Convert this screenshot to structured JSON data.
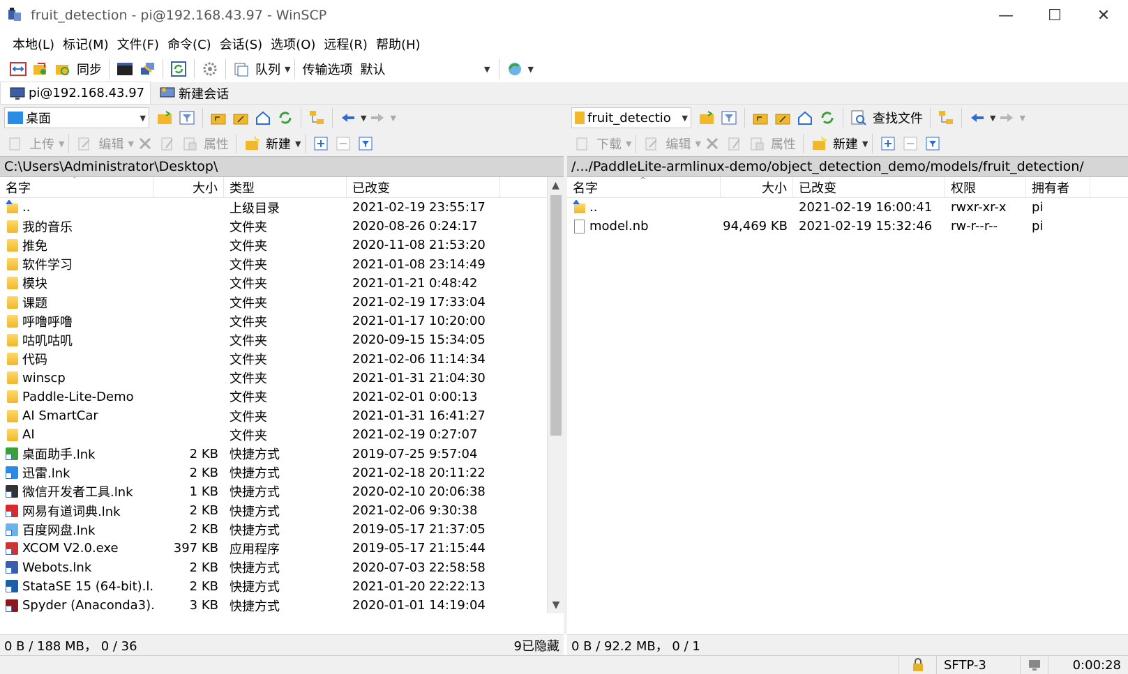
{
  "window": {
    "title": "fruit_detection - pi@192.168.43.97 - WinSCP",
    "minimize": "—",
    "maximize": "☐",
    "close": "✕"
  },
  "menu": [
    "本地(L)",
    "标记(M)",
    "文件(F)",
    "命令(C)",
    "会话(S)",
    "选项(O)",
    "远程(R)",
    "帮助(H)"
  ],
  "toolbar": {
    "sync_label": "同步",
    "queue_label": "队列",
    "transfer_label": "传输选项",
    "transfer_value": "默认"
  },
  "sessions": {
    "active": "pi@192.168.43.97",
    "new": "新建会话"
  },
  "left": {
    "location": "桌面",
    "actions": {
      "upload": "上传",
      "edit": "编辑",
      "properties": "属性",
      "new": "新建"
    },
    "path": "C:\\Users\\Administrator\\Desktop\\",
    "columns": {
      "name": "名字",
      "size": "大小",
      "type": "类型",
      "changed": "已改变"
    },
    "rows": [
      {
        "name": "..",
        "size": "",
        "type": "上级目录",
        "date": "2021-02-19",
        "time": "23:55:17",
        "icon": "parent"
      },
      {
        "name": "我的音乐",
        "size": "",
        "type": "文件夹",
        "date": "2020-08-26",
        "time": "0:24:17",
        "icon": "folder"
      },
      {
        "name": "推免",
        "size": "",
        "type": "文件夹",
        "date": "2020-11-08",
        "time": "21:53:20",
        "icon": "folder"
      },
      {
        "name": "软件学习",
        "size": "",
        "type": "文件夹",
        "date": "2021-01-08",
        "time": "23:14:49",
        "icon": "folder"
      },
      {
        "name": "模块",
        "size": "",
        "type": "文件夹",
        "date": "2021-01-21",
        "time": "0:48:42",
        "icon": "folder"
      },
      {
        "name": "课题",
        "size": "",
        "type": "文件夹",
        "date": "2021-02-19",
        "time": "17:33:04",
        "icon": "folder"
      },
      {
        "name": "呼噜呼噜",
        "size": "",
        "type": "文件夹",
        "date": "2021-01-17",
        "time": "10:20:00",
        "icon": "folder"
      },
      {
        "name": "咕叽咕叽",
        "size": "",
        "type": "文件夹",
        "date": "2020-09-15",
        "time": "15:34:05",
        "icon": "folder"
      },
      {
        "name": "代码",
        "size": "",
        "type": "文件夹",
        "date": "2021-02-06",
        "time": "11:14:34",
        "icon": "folder"
      },
      {
        "name": "winscp",
        "size": "",
        "type": "文件夹",
        "date": "2021-01-31",
        "time": "21:04:30",
        "icon": "folder"
      },
      {
        "name": "Paddle-Lite-Demo",
        "size": "",
        "type": "文件夹",
        "date": "2021-02-01",
        "time": "0:00:13",
        "icon": "folder"
      },
      {
        "name": "AI SmartCar",
        "size": "",
        "type": "文件夹",
        "date": "2021-01-31",
        "time": "16:41:27",
        "icon": "folder"
      },
      {
        "name": "AI",
        "size": "",
        "type": "文件夹",
        "date": "2021-02-19",
        "time": "0:27:07",
        "icon": "folder"
      },
      {
        "name": "桌面助手.lnk",
        "size": "2 KB",
        "type": "快捷方式",
        "date": "2019-07-25",
        "time": "9:57:04",
        "icon": "lnk-green"
      },
      {
        "name": "迅雷.lnk",
        "size": "2 KB",
        "type": "快捷方式",
        "date": "2021-02-18",
        "time": "20:11:22",
        "icon": "lnk-blue"
      },
      {
        "name": "微信开发者工具.lnk",
        "size": "1 KB",
        "type": "快捷方式",
        "date": "2020-02-10",
        "time": "20:06:38",
        "icon": "lnk-dark"
      },
      {
        "name": "网易有道词典.lnk",
        "size": "2 KB",
        "type": "快捷方式",
        "date": "2021-02-06",
        "time": "9:30:38",
        "icon": "lnk-red"
      },
      {
        "name": "百度网盘.lnk",
        "size": "2 KB",
        "type": "快捷方式",
        "date": "2019-05-17",
        "time": "21:37:05",
        "icon": "lnk-cloud"
      },
      {
        "name": "XCOM V2.0.exe",
        "size": "397 KB",
        "type": "应用程序",
        "date": "2019-05-17",
        "time": "21:15:44",
        "icon": "exe-xcom"
      },
      {
        "name": "Webots.lnk",
        "size": "2 KB",
        "type": "快捷方式",
        "date": "2020-07-03",
        "time": "22:58:58",
        "icon": "lnk-webots"
      },
      {
        "name": "StataSE 15 (64-bit).l...",
        "size": "2 KB",
        "type": "快捷方式",
        "date": "2021-01-20",
        "time": "22:22:13",
        "icon": "lnk-stata"
      },
      {
        "name": "Spyder (Anaconda3)...",
        "size": "3 KB",
        "type": "快捷方式",
        "date": "2020-01-01",
        "time": "14:19:04",
        "icon": "lnk-spyder"
      }
    ],
    "status": "0 B / 188 MB，  0 / 36",
    "hidden": "9已隐藏"
  },
  "right": {
    "location": "fruit_detection",
    "find_files": "查找文件",
    "actions": {
      "download": "下载",
      "edit": "编辑",
      "properties": "属性",
      "new": "新建"
    },
    "path": "/.../PaddleLite-armlinux-demo/object_detection_demo/models/fruit_detection/",
    "columns": {
      "name": "名字",
      "size": "大小",
      "changed": "已改变",
      "rights": "权限",
      "owner": "拥有者"
    },
    "rows": [
      {
        "name": "..",
        "size": "",
        "changed": "2021-02-19 16:00:41",
        "rights": "rwxr-xr-x",
        "owner": "pi",
        "icon": "parent"
      },
      {
        "name": "model.nb",
        "size": "94,469 KB",
        "changed": "2021-02-19 15:32:46",
        "rights": "rw-r--r--",
        "owner": "pi",
        "icon": "file"
      }
    ],
    "status": "0 B / 92.2 MB，  0 / 1"
  },
  "bottom": {
    "protocol": "SFTP-3",
    "elapsed": "0:00:28"
  },
  "colors": {
    "accent_blue": "#2b6cd6",
    "folder_yellow": "#f0b82a",
    "path_bg": "#d6d6d6"
  }
}
